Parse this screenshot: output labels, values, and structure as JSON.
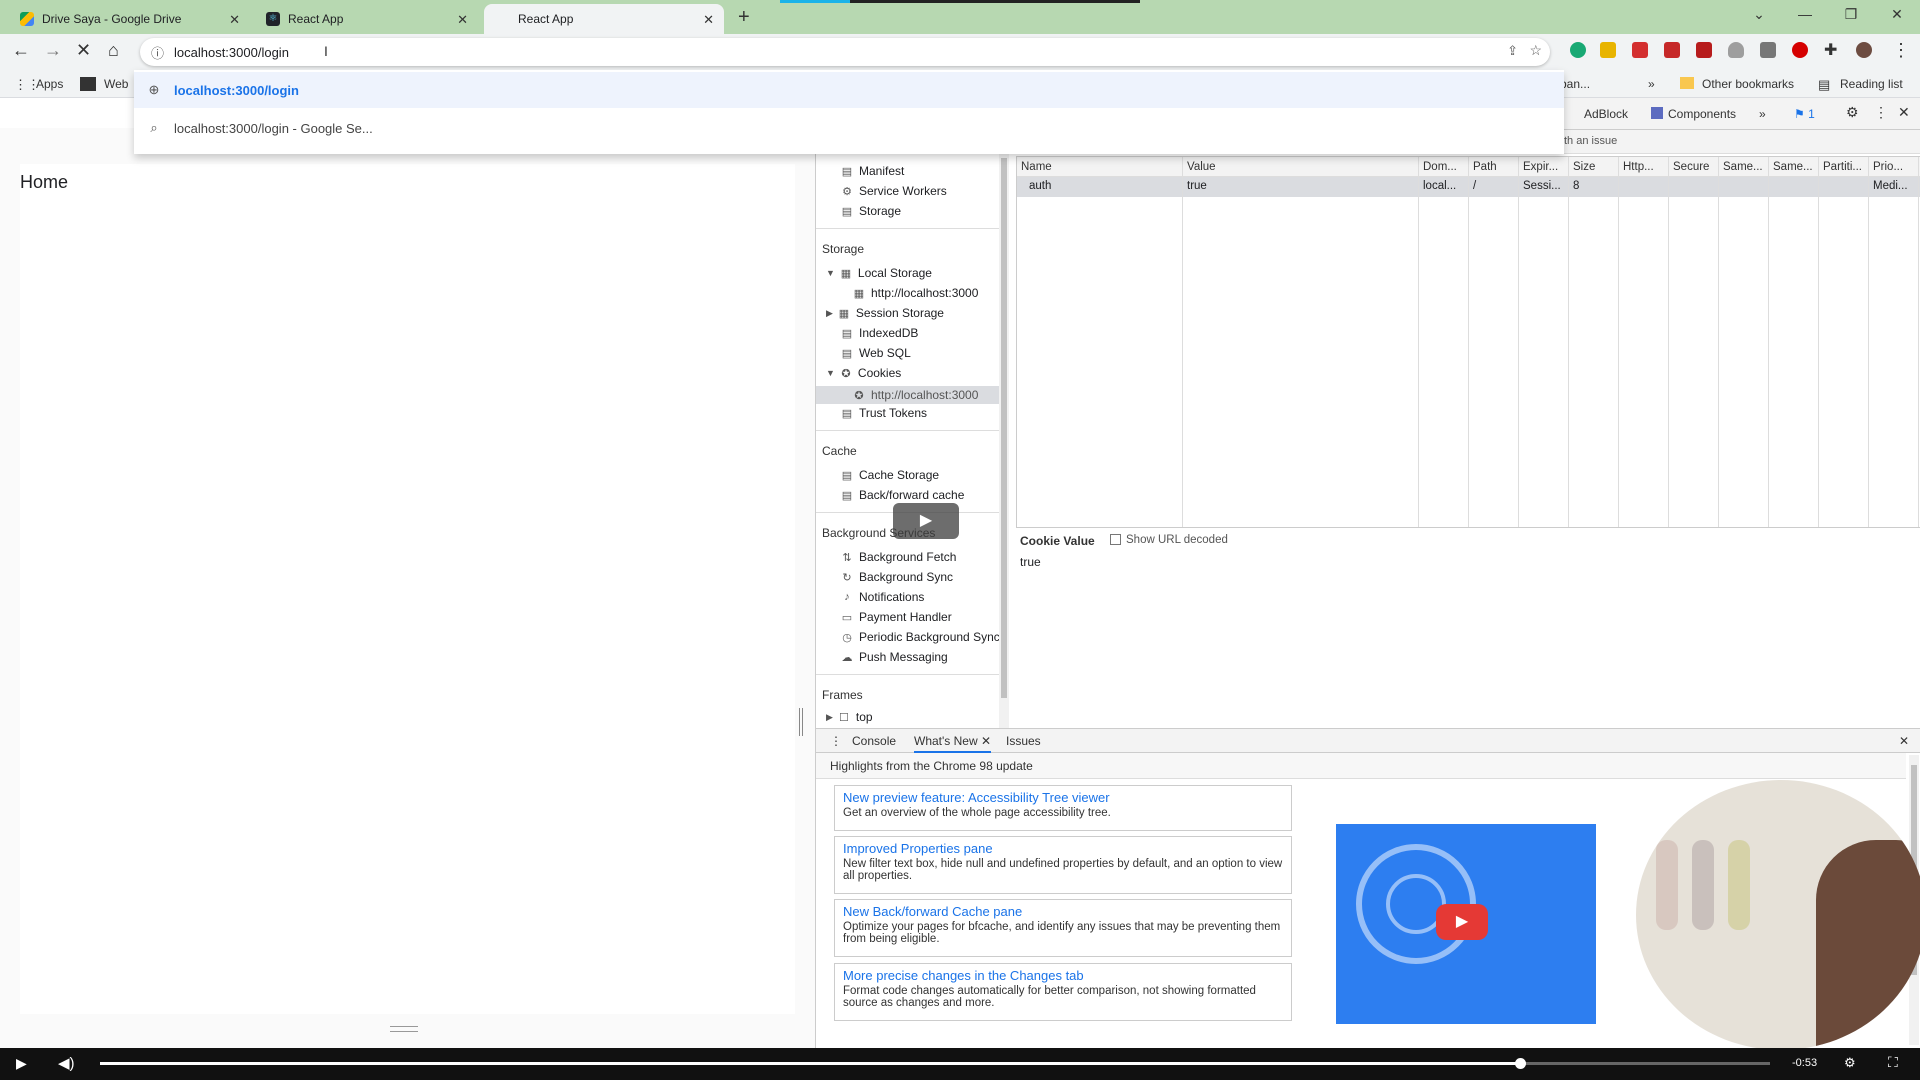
{
  "tabs": [
    {
      "title": "Drive Saya - Google Drive"
    },
    {
      "title": "React App"
    },
    {
      "title": "React App"
    }
  ],
  "address": {
    "url": "localhost:3000/login"
  },
  "omnibox_suggestions": [
    {
      "text": "localhost:3000/login"
    },
    {
      "text": "localhost:3000/login - Google Se..."
    }
  ],
  "bookmarks": {
    "apps": "Apps",
    "web": "Web",
    "ban": "ban...",
    "more": "»",
    "other": "Other bookmarks",
    "reading": "Reading list"
  },
  "page": {
    "heading": "Home"
  },
  "devtools": {
    "top_tabs": [
      "AdBlock",
      "Components",
      "»"
    ],
    "issue_count": "1",
    "sub_text": "th an issue",
    "sidebar": {
      "app_items": [
        "Manifest",
        "Service Workers",
        "Storage"
      ],
      "storage_label": "Storage",
      "storage_items": [
        "Local Storage",
        "http://localhost:3000",
        "Session Storage",
        "IndexedDB",
        "Web SQL",
        "Cookies",
        "http://localhost:3000",
        "Trust Tokens"
      ],
      "cache_label": "Cache",
      "cache_items": [
        "Cache Storage",
        "Back/forward cache"
      ],
      "bg_label": "Background Services",
      "bg_items": [
        "Background Fetch",
        "Background Sync",
        "Notifications",
        "Payment Handler",
        "Periodic Background Sync",
        "Push Messaging"
      ],
      "frames_label": "Frames",
      "frames_items": [
        "top"
      ]
    },
    "cookie_table": {
      "headers": [
        "Name",
        "Value",
        "Dom...",
        "Path",
        "Expir...",
        "Size",
        "Http...",
        "Secure",
        "Same...",
        "Same...",
        "Partiti...",
        "Prio..."
      ],
      "rows": [
        [
          "auth",
          "true",
          "local...",
          "/",
          "Sessi...",
          "8",
          "",
          "",
          "",
          "",
          "",
          "Medi..."
        ]
      ]
    },
    "cookie_value": {
      "label": "Cookie Value",
      "checkbox": "Show URL decoded",
      "value": "true"
    },
    "drawer": {
      "tabs": [
        "Console",
        "What's New",
        "Issues"
      ],
      "headline": "Highlights from the Chrome 98 update",
      "cards": [
        {
          "title": "New preview feature: Accessibility Tree viewer",
          "desc": "Get an overview of the whole page accessibility tree."
        },
        {
          "title": "Improved Properties pane",
          "desc": "New filter text box, hide null and undefined properties by default, and an option to view all properties."
        },
        {
          "title": "New Back/forward Cache pane",
          "desc": "Optimize your pages for bfcache, and identify any issues that may be preventing them from being eligible."
        },
        {
          "title": "More precise changes in the Changes tab",
          "desc": "Format code changes automatically for better comparison, not showing formatted source as changes and more."
        }
      ]
    }
  },
  "video": {
    "time": "-0:53",
    "progress": 0.85
  },
  "colors": {
    "tabstrip": "#b7d8b1",
    "link": "#1a73e8",
    "banner": "#2d7ef0"
  },
  "icons": [
    "back-icon",
    "forward-icon",
    "reload-icon",
    "home-icon",
    "info-icon",
    "share-icon",
    "star-icon",
    "puzzle-icon",
    "kebab-icon",
    "gear-icon",
    "close-icon",
    "play-icon",
    "volume-icon",
    "settings-icon",
    "fullscreen-icon"
  ]
}
